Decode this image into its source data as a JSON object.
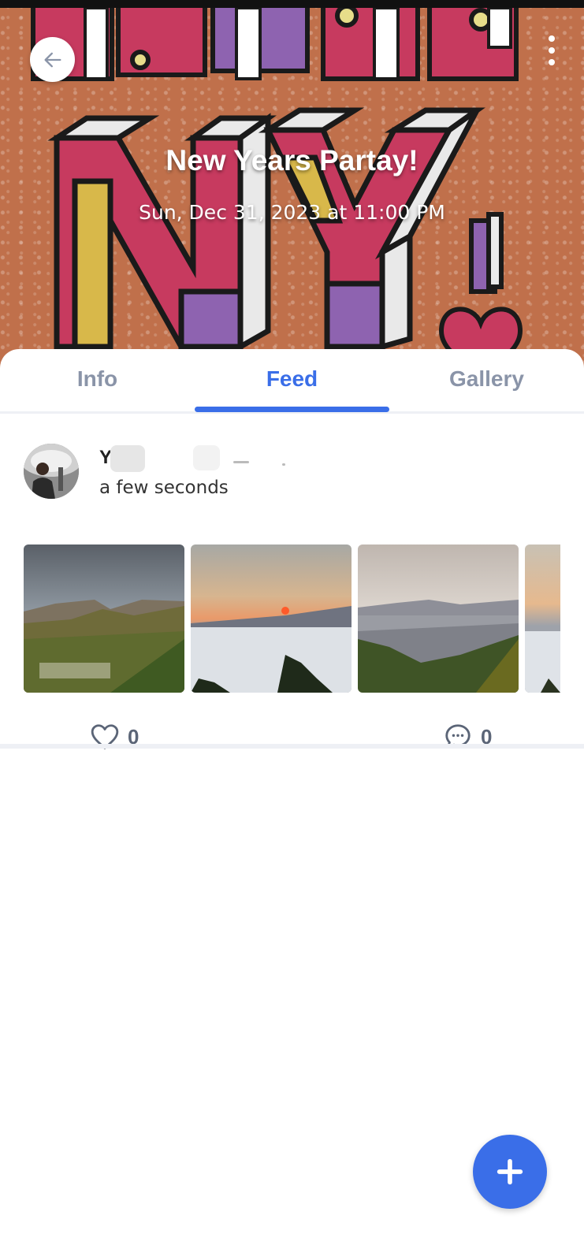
{
  "event": {
    "title": "New Years Partay!",
    "date": "Sun, Dec 31, 2023 at 11:00 PM"
  },
  "header": {
    "back_icon": "arrow-left-icon",
    "menu_icon": "more-vertical-icon"
  },
  "tabs": [
    {
      "label": "Info",
      "active": false
    },
    {
      "label": "Feed",
      "active": true
    },
    {
      "label": "Gallery",
      "active": false
    }
  ],
  "post": {
    "author_initial": "Y",
    "timestamp": "a few seconds",
    "likes": "0",
    "comments": "0",
    "photos": [
      "mountain-village",
      "sunrise-sea-of-clouds",
      "city-valley-view",
      "sea-of-clouds-partial"
    ]
  },
  "fab": {
    "icon": "plus-icon"
  },
  "colors": {
    "accent": "#3a6ee8",
    "banner": "#c0704b",
    "inactive_tab": "#8a94a8"
  }
}
